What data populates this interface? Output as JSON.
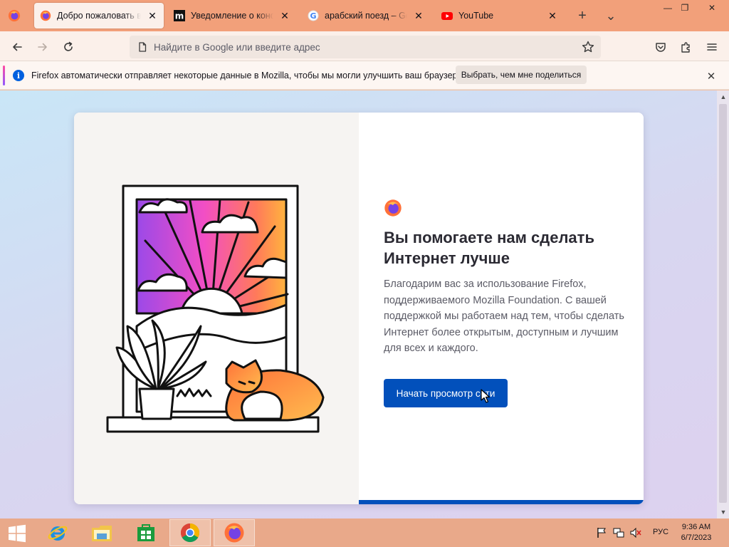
{
  "colors": {
    "accent": "#0250bb",
    "tabstrip": "#f2a07a",
    "taskbar": "#e9a98a",
    "notification_info": "#0060df"
  },
  "tabs": [
    {
      "title": "Добро пожаловать в Firefox",
      "icon": "firefox-icon",
      "active": true
    },
    {
      "title": "Уведомление о конфиденциальности",
      "icon": "mozilla-m-icon",
      "active": false
    },
    {
      "title": "арабский поезд – Google",
      "icon": "google-g-icon",
      "active": false
    },
    {
      "title": "YouTube",
      "icon": "youtube-icon",
      "active": false
    }
  ],
  "tab_close_glyph": "✕",
  "new_tab_glyph": "+",
  "list_tabs_glyph": "⌄",
  "window_controls": {
    "minimize": "—",
    "restore": "❐",
    "close": "✕"
  },
  "urlbar": {
    "placeholder": "Найдите в Google или введите адрес"
  },
  "notification": {
    "text": "Firefox автоматически отправляет некоторые данные в Mozilla, чтобы мы могли улучшить ваш браузер.",
    "button": "Выбрать, чем мне поделиться",
    "info_glyph": "i",
    "close_glyph": "✕"
  },
  "welcome": {
    "title": "Вы помогаете нам сделать Интернет лучше",
    "body": "Благодарим вас за использование Firefox, поддерживаемого Mozilla Foundation. С вашей поддержкой мы работаем над тем, чтобы сделать Интернет более открытым, доступным и лучшим для всех и каждого.",
    "button": "Начать просмотр сети",
    "progress": 1.0
  },
  "scrollbar": {
    "up": "▲",
    "down": "▼"
  },
  "taskbar": {
    "apps": [
      {
        "name": "internet-explorer-icon"
      },
      {
        "name": "file-explorer-icon"
      },
      {
        "name": "store-icon"
      },
      {
        "name": "chrome-icon"
      },
      {
        "name": "firefox-icon",
        "active": true
      }
    ],
    "language": "РУС",
    "time": "9:36 AM",
    "date": "6/7/2023"
  }
}
